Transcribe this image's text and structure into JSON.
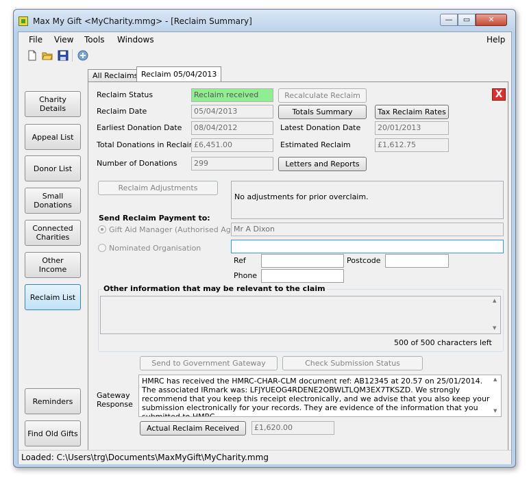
{
  "window": {
    "title": "Max My Gift <MyCharity.mmg>  - [Reclaim Summary]",
    "minimize_glyph": "—",
    "maximize_glyph": "▭",
    "close_glyph": "✕"
  },
  "menu": {
    "file": "File",
    "view": "View",
    "tools": "Tools",
    "windows": "Windows",
    "help": "Help"
  },
  "toolbar": {
    "icons": [
      "new-document-icon",
      "open-folder-icon",
      "save-icon",
      "gift-aid-icon"
    ]
  },
  "sidebar": {
    "charity_details": "Charity Details",
    "appeal_list": "Appeal List",
    "donor_list": "Donor List",
    "small_donations": "Small Donations",
    "connected_charities": "Connected Charities",
    "other_income": "Other Income",
    "reclaim_list": "Reclaim List",
    "reminders": "Reminders",
    "find_old_gifts": "Find Old Gifts"
  },
  "tabs": {
    "all_reclaims": "All Reclaims",
    "reclaim_date": "Reclaim 05/04/2013"
  },
  "form": {
    "reclaim_status_label": "Reclaim Status",
    "reclaim_status_value": "Reclaim received",
    "reclaim_date_label": "Reclaim Date",
    "reclaim_date_value": "05/04/2013",
    "earliest_label": "Earliest Donation Date",
    "earliest_value": "08/04/2012",
    "latest_label": "Latest Donation Date",
    "latest_value": "20/01/2013",
    "total_label": "Total Donations in Reclaim",
    "total_value": "£6,451.00",
    "estimated_label": "Estimated Reclaim",
    "estimated_value": "£1,612.75",
    "number_label": "Number of Donations",
    "number_value": "299",
    "recalculate_btn": "Recalculate Reclaim",
    "totals_summary_btn": "Totals Summary",
    "tax_rates_btn": "Tax Reclaim Rates",
    "letters_btn": "Letters and Reports",
    "adjustments_btn": "Reclaim Adjustments",
    "adjustments_text": "No adjustments for prior overclaim.",
    "send_payment_label": "Send Reclaim Payment to:",
    "gift_aid_manager_label": "Gift Aid Manager (Authorised Agent)",
    "gift_aid_manager_value": "Mr A Dixon",
    "nominated_label": "Nominated Organisation",
    "nominated_value": "",
    "ref_label": "Ref",
    "postcode_label": "Postcode",
    "phone_label": "Phone",
    "other_info_label": "Other information that may be relevant to the claim",
    "chars_left": "500 of 500 characters left",
    "send_gateway_btn": "Send to Government Gateway",
    "check_status_btn": "Check Submission Status",
    "gateway_label": "Gateway Response",
    "gateway_text": "HMRC has received the HMRC-CHAR-CLM document ref: AB12345 at 20.57 on 25/01/2014. The associated IRmark was: LFJYUEOG4RDENE2OBWLTLQM3EX7TKSZD. We strongly recommend that you keep this receipt electronically, and we advise that you also keep your submission electronically for your records. They are evidence of the information that you submitted to HMRC.",
    "actual_received_btn": "Actual Reclaim Received",
    "actual_received_value": "£1,620.00",
    "close_glyph": "X"
  },
  "status": {
    "text": "Loaded: C:\\Users\\trg\\Documents\\MaxMyGift\\MyCharity.mmg"
  }
}
